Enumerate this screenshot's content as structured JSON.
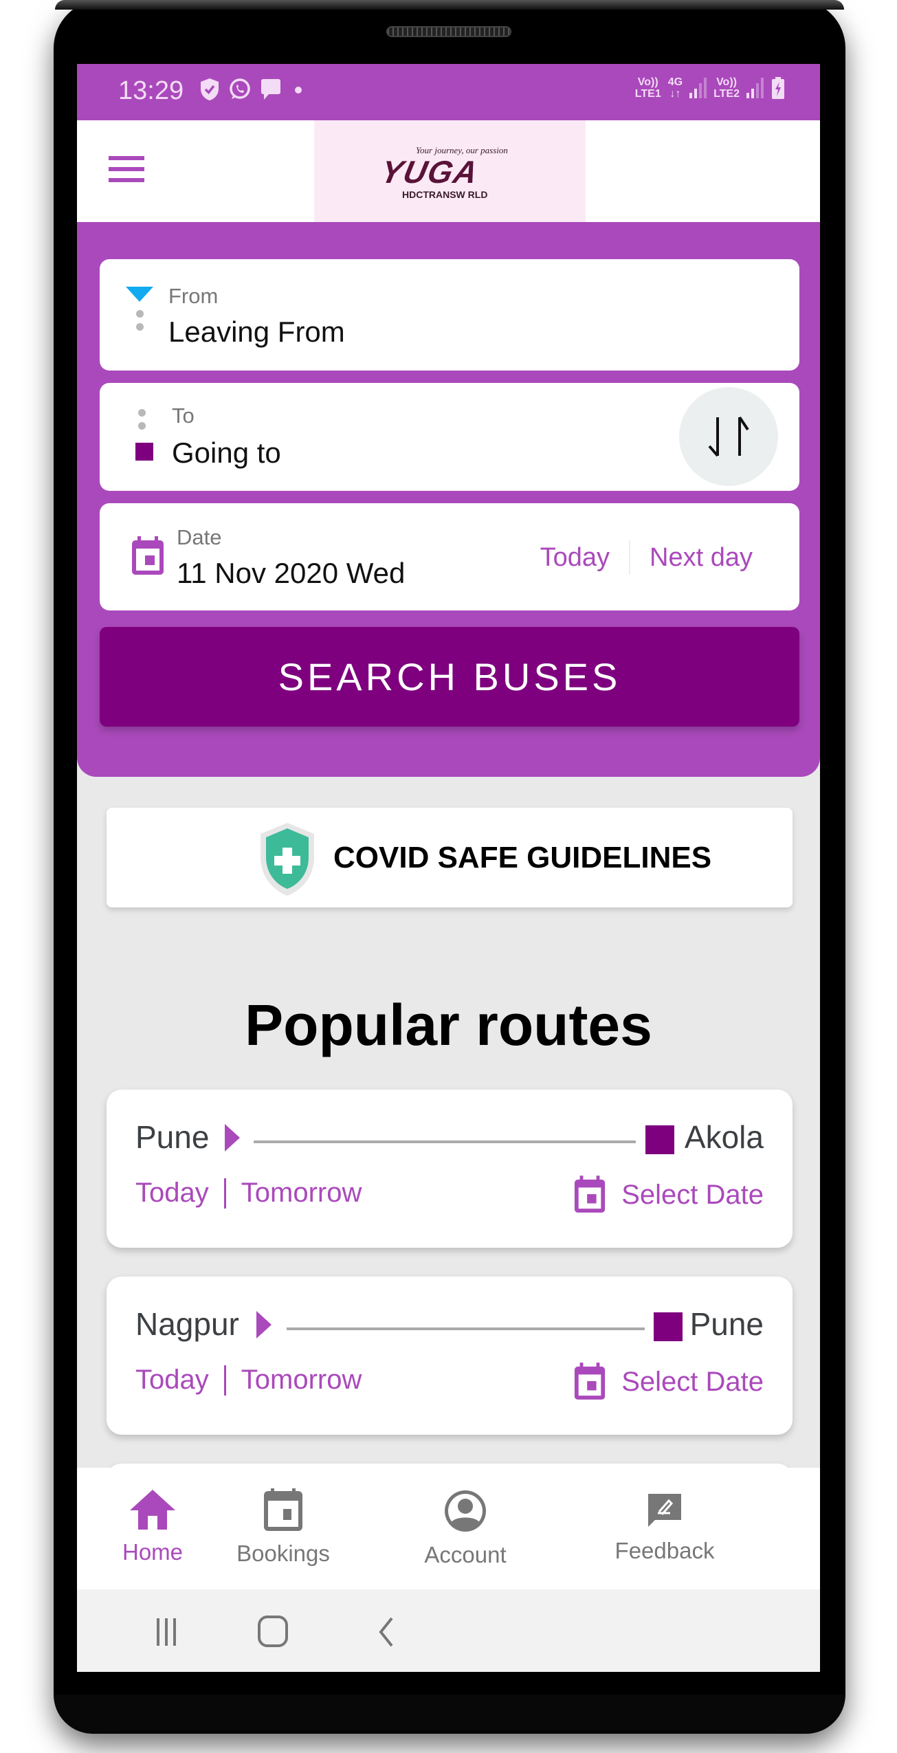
{
  "status_bar": {
    "time": "13:29",
    "left_icons": [
      "shield-check-icon",
      "whatsapp-icon",
      "message-icon",
      "notification-dot-icon"
    ],
    "sim1": {
      "top": "Vo))",
      "bottom": "LTE1"
    },
    "network": {
      "top": "4G",
      "bottom": "↓↑"
    },
    "sim2": {
      "top": "Vo))",
      "bottom": "LTE2"
    },
    "battery": "charging"
  },
  "app_bar": {
    "menu_icon": "hamburger-menu-icon",
    "logo": {
      "tagline": "Your journey, our passion",
      "brand": "YUGA",
      "subtitle": "HDCTRANSW RLD"
    }
  },
  "search_form": {
    "from": {
      "label": "From",
      "value": "Leaving From"
    },
    "to": {
      "label": "To",
      "value": "Going to"
    },
    "swap_icon": "swap-vertical-icon",
    "date": {
      "label": "Date",
      "value": "11 Nov 2020 Wed",
      "quick_links": [
        "Today",
        "Next day"
      ]
    },
    "search_button": "SEARCH BUSES"
  },
  "covid_banner": {
    "label": "COVID SAFE GUIDELINES",
    "icon": "medical-shield-icon"
  },
  "popular_routes": {
    "heading": "Popular routes",
    "routes": [
      {
        "from": "Pune",
        "to": "Akola",
        "today": "Today",
        "tomorrow": "Tomorrow",
        "select_date": "Select Date"
      },
      {
        "from": "Nagpur",
        "to": "Pune",
        "today": "Today",
        "tomorrow": "Tomorrow",
        "select_date": "Select Date"
      }
    ]
  },
  "bottom_nav": {
    "items": [
      {
        "label": "Home",
        "icon": "home-icon",
        "active": true
      },
      {
        "label": "Bookings",
        "icon": "calendar-icon",
        "active": false
      },
      {
        "label": "Account",
        "icon": "account-circle-icon",
        "active": false
      },
      {
        "label": "Feedback",
        "icon": "feedback-icon",
        "active": false
      }
    ]
  },
  "system_nav": {
    "buttons": [
      "recent-apps",
      "home",
      "back"
    ]
  },
  "colors": {
    "primary": "#aa49bb",
    "primary_dark": "#7e007e",
    "from_marker": "#12aaf0",
    "covid_green": "#3dbb98",
    "background": "#e9e9e9"
  }
}
